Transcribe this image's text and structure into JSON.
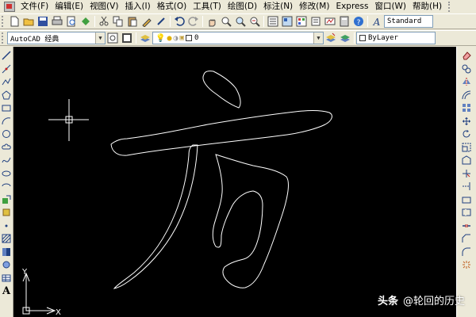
{
  "menu": {
    "items": [
      "文件(F)",
      "编辑(E)",
      "视图(V)",
      "插入(I)",
      "格式(O)",
      "工具(T)",
      "绘图(D)",
      "标注(N)",
      "修改(M)",
      "Express",
      "窗口(W)",
      "帮助(H)"
    ]
  },
  "toolbar1": {
    "text_style_value": "Standard"
  },
  "toolbar2": {
    "workspace_value": "AutoCAD 经典",
    "layer_value": "0",
    "linetype_value": "ByLayer"
  },
  "canvas": {
    "background": "#000000",
    "stroke": "#ffffff",
    "character": "方",
    "ucs_y_label": "Y",
    "ucs_x_label": "X"
  },
  "watermark": {
    "prefix": "头条",
    "handle": "@轮回的历史"
  },
  "colors": {
    "chrome": "#ece9d8",
    "canvas": "#000000",
    "outline": "#ffffff"
  }
}
